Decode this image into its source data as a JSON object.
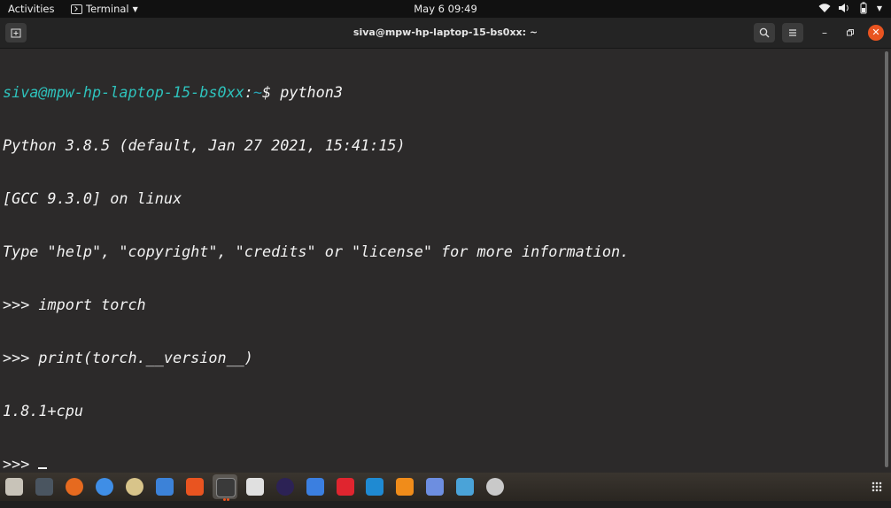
{
  "topbar": {
    "activities": "Activities",
    "app_name": "Terminal",
    "clock": "May 6  09:49"
  },
  "window": {
    "title": "siva@mpw-hp-laptop-15-bs0xx: ~"
  },
  "terminal": {
    "prompt_user": "siva@mpw-hp-laptop-15-bs0xx",
    "prompt_sep": ":",
    "prompt_path": "~",
    "prompt_symbol": "$ ",
    "command": "python3",
    "lines": [
      "Python 3.8.5 (default, Jan 27 2021, 15:41:15)",
      "[GCC 9.3.0] on linux",
      "Type \"help\", \"copyright\", \"credits\" or \"license\" for more information.",
      ">>> import torch",
      ">>> print(torch.__version__)",
      "1.8.1+cpu"
    ],
    "current_prompt": ">>> "
  },
  "dock": {
    "icons": [
      {
        "name": "files-icon",
        "color": "#c8c3b8"
      },
      {
        "name": "system-monitor-icon",
        "color": "#4a5560"
      },
      {
        "name": "firefox-icon",
        "color": "#e66a1f"
      },
      {
        "name": "chrome-icon",
        "color": "#3f8ee6"
      },
      {
        "name": "rhythmbox-icon",
        "color": "#d8c48a"
      },
      {
        "name": "text-editor-icon",
        "color": "#3c82d8"
      },
      {
        "name": "ubuntu-software-icon",
        "color": "#e95420"
      },
      {
        "name": "terminal-icon",
        "color": "#3a3a3a"
      },
      {
        "name": "code-editor-icon",
        "color": "#e0e0e0"
      },
      {
        "name": "eclipse-icon",
        "color": "#2c2255"
      },
      {
        "name": "notes-icon",
        "color": "#3b7fe0"
      },
      {
        "name": "anydesk-icon",
        "color": "#e0252f"
      },
      {
        "name": "vscode-icon",
        "color": "#1f8ad2"
      },
      {
        "name": "vlc-icon",
        "color": "#f08c1a"
      },
      {
        "name": "tool-icon",
        "color": "#6d8ee0"
      },
      {
        "name": "image-viewer-icon",
        "color": "#4aa3d8"
      },
      {
        "name": "disc-icon",
        "color": "#c9c9c9"
      }
    ]
  }
}
